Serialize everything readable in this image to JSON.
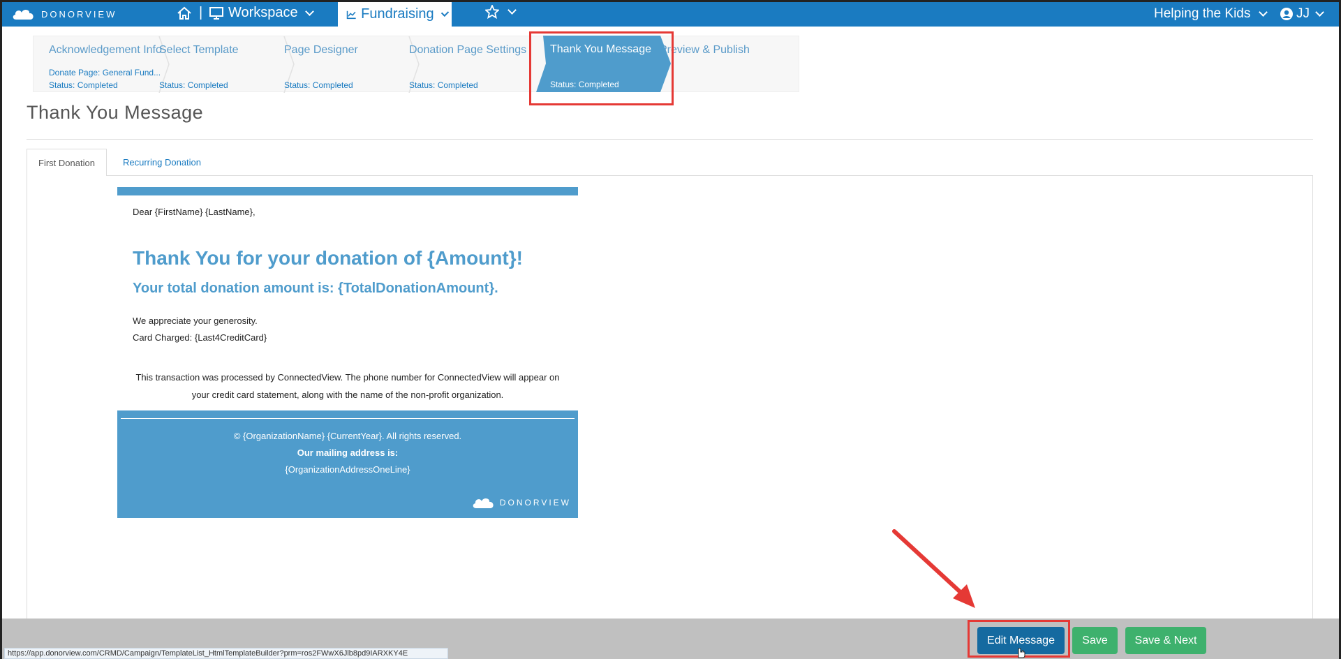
{
  "topnav": {
    "logo_text": "DONORVIEW",
    "workspace_label": "Workspace",
    "fundraising_label": "Fundraising",
    "org_label": "Helping the Kids",
    "user_label": "JJ",
    "bg_color": "#1a7bc1"
  },
  "steps": [
    {
      "name": "Acknowledgement Info",
      "sub": "Donate Page: General Fund...",
      "status": "Status: Completed"
    },
    {
      "name": "Select Template",
      "status": "Status: Completed"
    },
    {
      "name": "Page Designer",
      "status": "Status: Completed"
    },
    {
      "name": "Donation Page Settings",
      "status": "Status: Completed"
    },
    {
      "name": "Thank You Message",
      "status": "Status: Completed",
      "active": true
    },
    {
      "name": "Preview & Publish"
    }
  ],
  "page_title": "Thank You Message",
  "tabs": [
    {
      "label": "First Donation",
      "active": true
    },
    {
      "label": "Recurring Donation"
    }
  ],
  "message": {
    "greeting": "Dear {FirstName} {LastName},",
    "headline": "Thank You for your donation of {Amount}!",
    "total": "Your total donation amount is: {TotalDonationAmount}.",
    "line1": "We appreciate your generosity.",
    "line2": "Card Charged: {Last4CreditCard}",
    "transaction": "This transaction was processed by ConnectedView. The phone number for ConnectedView will appear on your credit card statement, along with the name of the non-profit organization.",
    "footer_copyright": "© {OrganizationName} {CurrentYear}. All rights reserved.",
    "footer_mailing": "Our mailing address is:",
    "footer_address": "{OrganizationAddressOneLine}",
    "footer_logo_text": "DONORVIEW",
    "accent_color": "#4f9ccc"
  },
  "bottombar": {
    "edit_label": "Edit Message",
    "save_label": "Save",
    "save_next_label": "Save & Next",
    "status_url": "https://app.donorview.com/CRMD/Campaign/TemplateList_HtmlTemplateBuilder?prm=ros2FWwX6Jlb8pd9IARXKY4E"
  }
}
